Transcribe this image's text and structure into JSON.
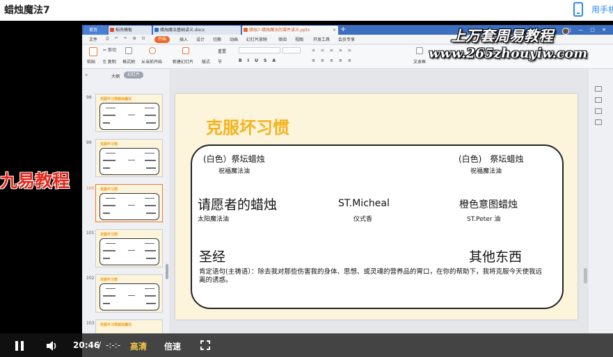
{
  "header": {
    "video_title": "蜡烛魔法7",
    "phone_label": "用手机"
  },
  "wps": {
    "tabs": [
      {
        "label": "首页"
      },
      {
        "label": "稻壳模板"
      },
      {
        "label": "蜡烛魔法基础讲义.docx"
      },
      {
        "label": "蜡烛7-蜡烛魔法的课件讲义.pptx"
      }
    ],
    "tab_add": "+",
    "menu": [
      "文件",
      "开始",
      "插入",
      "设计",
      "切换",
      "动画",
      "幻灯片放映",
      "审阅",
      "视图",
      "开发工具",
      "会员专享"
    ],
    "ribbon": {
      "paste": "粘贴",
      "cut": "剪切",
      "copy": "复制",
      "format_painter": "格式刷",
      "from_start": "从当前开始",
      "new_slide": "新建幻灯片",
      "layout": "版式",
      "section": "节",
      "reset": "重置",
      "textbox": "文本框"
    },
    "left_panel": {
      "outline": "大纲",
      "slides": "幻灯片",
      "thumbs": [
        {
          "num": "98",
          "title": "克服坏习惯蜡烛魔法"
        },
        {
          "num": "99",
          "title": "克服坏习惯"
        },
        {
          "num": "100",
          "title": "克服坏习惯"
        },
        {
          "num": "101",
          "title": "克服坏习惯"
        },
        {
          "num": "102",
          "title": "克服坏习惯"
        },
        {
          "num": "103",
          "title": "克服坏习惯蜡烛魔法"
        }
      ]
    },
    "slide": {
      "title": "克服坏习惯",
      "left_candle": "(白色）祭坛蜡烛",
      "left_candle_sub": "祝福魔法油",
      "right_candle": "(白色)　祭坛蜡烛",
      "right_candle_sub": "祝福魔法油",
      "petitioner": "请愿者的蜡烛",
      "petitioner_sub": "太阳魔法油",
      "st_michael": "ST.Micheal",
      "st_michael_sub": "仪式香",
      "orange": "橙色意图蜡烛",
      "orange_sub": "ST.Peter 油",
      "bible": "圣经",
      "other": "其他东西",
      "affirmation": "肯定语句(主祷语）：除去我对那些伤害我的身体、思想、或灵魂的营养品的胃口，在你的帮助下，我将克服今天使我远离的诱惑。"
    }
  },
  "watermark": {
    "line1": "上万套周易教程",
    "line2": "www.265zhouyiw.com"
  },
  "side_overlay": "九易教程",
  "player": {
    "current_time": "20:46",
    "separator": "/",
    "total_time": "-:-:-",
    "quality": "高清",
    "speed": "倍速"
  }
}
